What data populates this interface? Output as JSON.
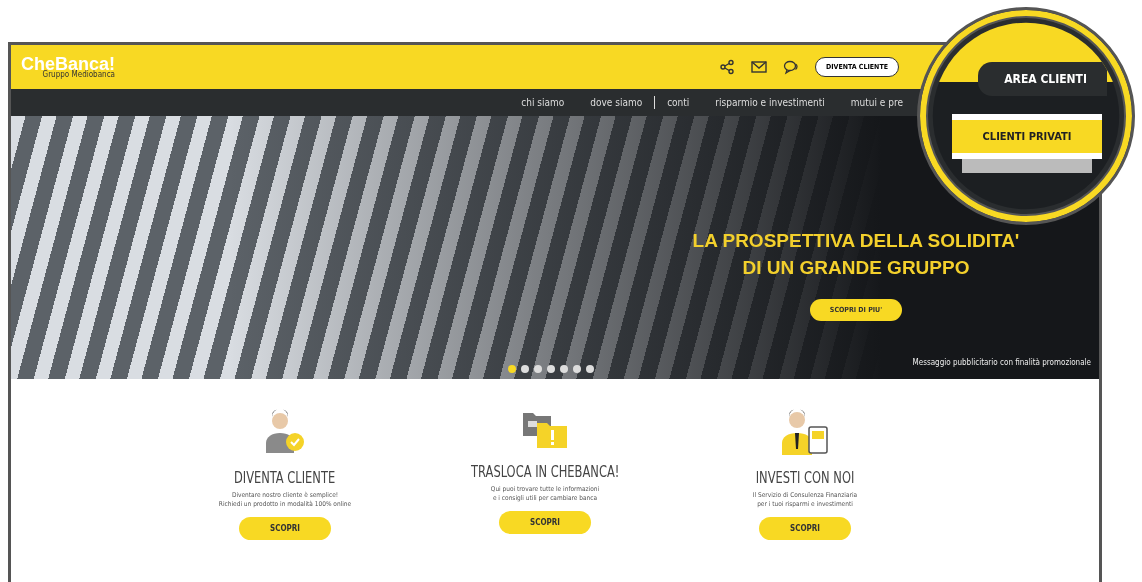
{
  "header": {
    "logo": "CheBanca!",
    "logo_sub": "Gruppo Mediobanca",
    "cta": "DIVENTA CLIENTE"
  },
  "nav": [
    "chi siamo",
    "dove siamo",
    "conti",
    "risparmio e investimenti",
    "mutui e pre"
  ],
  "hero": {
    "headline": [
      "LA PROSPETTIVA DELLA SOLIDITA'",
      "DI UN GRANDE GRUPPO"
    ],
    "button": "SCOPRI DI PIU'",
    "disclaimer": "Messaggio pubblicitario con finalità promozionale",
    "slides": [
      {
        "selected": true
      },
      {
        "selected": false
      },
      {
        "selected": false
      },
      {
        "selected": false
      },
      {
        "selected": false
      },
      {
        "selected": false
      },
      {
        "selected": false
      }
    ]
  },
  "features": [
    {
      "kind": "person-check",
      "title": "DIVENTA CLIENTE",
      "text": [
        "Diventare nostro cliente è semplice!",
        "Richiedi un prodotto in modalità 100% online"
      ],
      "button": "SCOPRI"
    },
    {
      "kind": "folders",
      "title": "TRASLOCA IN CHEBANCA!",
      "text": [
        "Qui puoi trovare tutte le informazioni",
        "e i consigli utili per cambiare banca"
      ],
      "button": "SCOPRI"
    },
    {
      "kind": "advisor",
      "title": "INVESTI CON NOI",
      "text": [
        "Il Servizio di Consulenza Finanziaria",
        "per i tuoi risparmi e investimenti"
      ],
      "button": "SCOPRI"
    }
  ],
  "magnifier": {
    "area": "AREA CLIENTI",
    "private": "CLIENTI PRIVATI"
  }
}
